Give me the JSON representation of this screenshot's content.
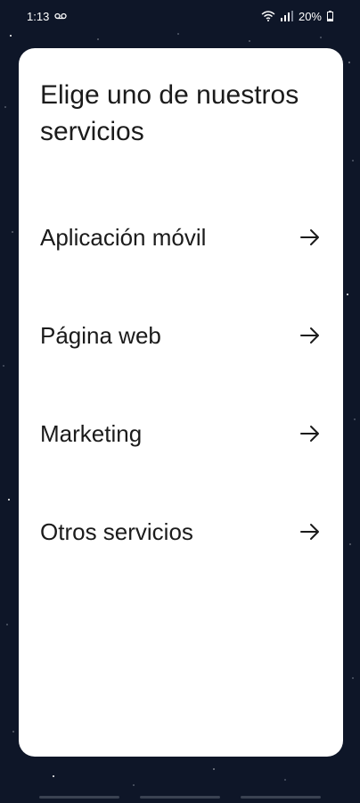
{
  "status_bar": {
    "time": "1:13",
    "battery": "20%",
    "icons": [
      "voicemail-icon",
      "wifi-icon",
      "signal-icon",
      "battery-icon"
    ]
  },
  "card": {
    "title": "Elige uno de nuestros servicios",
    "services": [
      {
        "label": "Aplicación móvil",
        "icon": "arrow-right-icon"
      },
      {
        "label": "Página web",
        "icon": "arrow-right-icon"
      },
      {
        "label": "Marketing",
        "icon": "arrow-right-icon"
      },
      {
        "label": "Otros servicios",
        "icon": "arrow-right-icon"
      }
    ]
  },
  "colors": {
    "background": "#0e1628",
    "card": "#ffffff",
    "text": "#1b1b1b"
  }
}
